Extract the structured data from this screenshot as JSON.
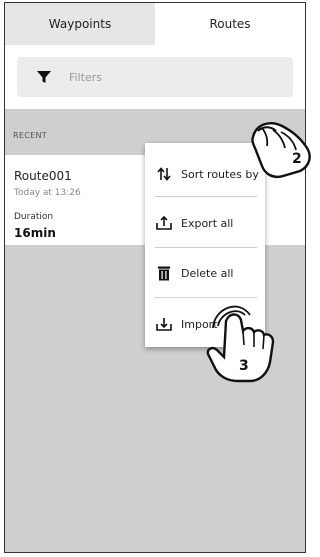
{
  "tabs": {
    "waypoints": "Waypoints",
    "routes": "Routes"
  },
  "filter": {
    "label": "Filters",
    "icon": "filter-icon"
  },
  "recent": {
    "header": "RECENT"
  },
  "route": {
    "name": "Route001",
    "time": "Today at 13:26",
    "duration_label": "Duration",
    "duration_value": "16min"
  },
  "menu": {
    "items": [
      {
        "label": "Sort routes by",
        "icon": "sort-icon"
      },
      {
        "label": "Export all",
        "icon": "export-icon"
      },
      {
        "label": "Delete all",
        "icon": "trash-icon"
      },
      {
        "label": "Import",
        "icon": "import-icon"
      }
    ]
  },
  "callouts": {
    "step2": "2",
    "step3": "3"
  }
}
